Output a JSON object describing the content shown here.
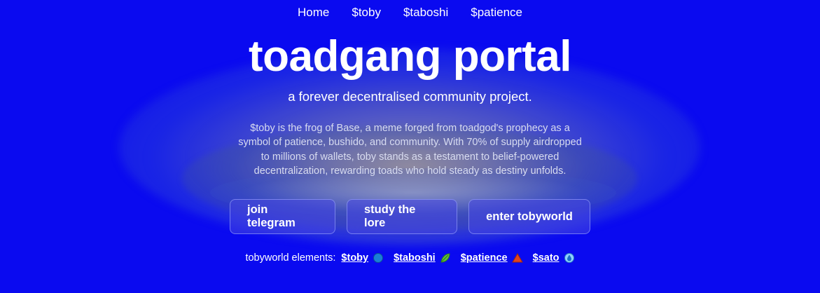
{
  "nav": {
    "items": [
      {
        "label": "Home"
      },
      {
        "label": "$toby"
      },
      {
        "label": "$taboshi"
      },
      {
        "label": "$patience"
      }
    ]
  },
  "hero": {
    "title": "toadgang portal",
    "subtitle": "a forever decentralised community project.",
    "description": "$toby is the frog of Base, a meme forged from toadgod's prophecy as a symbol of patience, bushido, and community. With 70% of supply airdropped to millions of wallets, toby stands as a testament to belief-powered decentralization, rewarding toads who hold steady as destiny unfolds."
  },
  "buttons": {
    "telegram": "join telegram",
    "lore": "study the lore",
    "tobyworld": "enter tobyworld"
  },
  "elements": {
    "label": "tobyworld elements:",
    "items": [
      {
        "label": "$toby",
        "icon": "blue-circle-icon"
      },
      {
        "label": "$taboshi",
        "icon": "leaf-icon"
      },
      {
        "label": "$patience",
        "icon": "red-triangle-icon"
      },
      {
        "label": "$sato",
        "icon": "water-drop-icon"
      }
    ]
  },
  "colors": {
    "background": "#0000ee",
    "text": "#ffffff",
    "button_bg": "#4646e1"
  }
}
